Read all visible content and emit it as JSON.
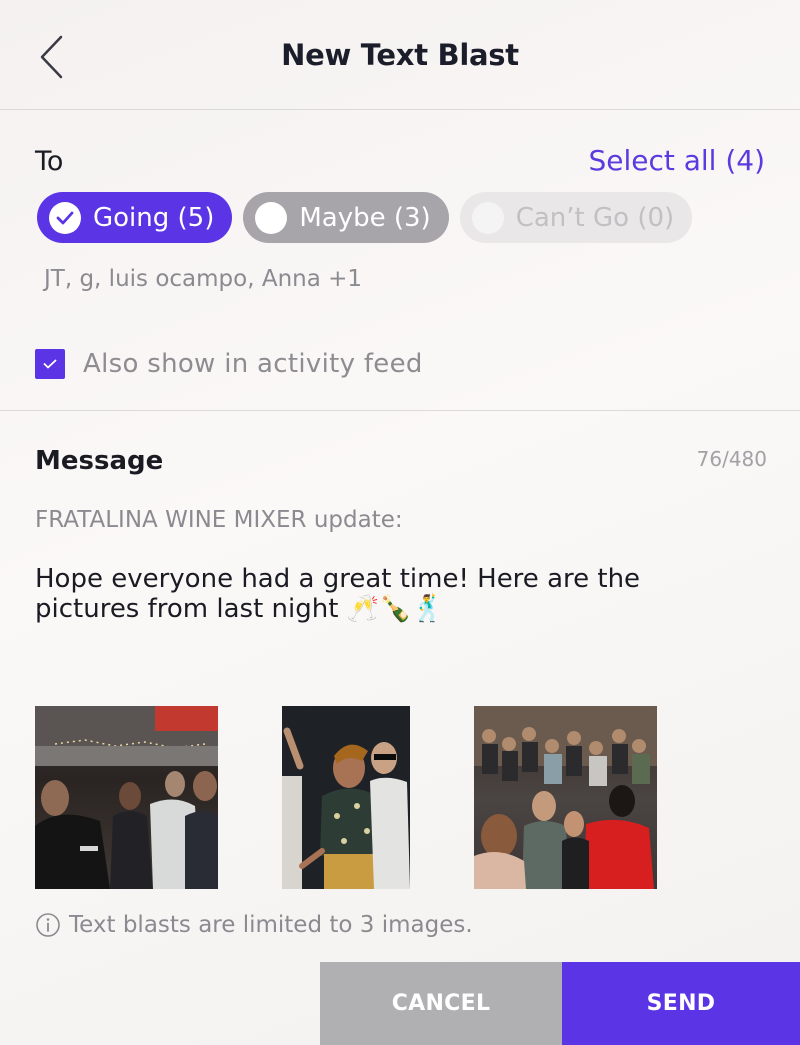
{
  "header": {
    "title": "New Text Blast",
    "back_icon": "chevron-left-icon"
  },
  "recipients": {
    "to_label": "To",
    "select_all_label": "Select all (4)",
    "chips": [
      {
        "label": "Going (5)",
        "selected": true,
        "state": "active"
      },
      {
        "label": "Maybe (3)",
        "selected": false,
        "state": "enabled"
      },
      {
        "label": "Can’t Go (0)",
        "selected": false,
        "state": "disabled"
      }
    ],
    "names": "JT, g, luis ocampo, Anna +1"
  },
  "activity_feed": {
    "label": "Also show in activity feed",
    "checked": true
  },
  "message": {
    "label": "Message",
    "counter": "76/480",
    "subject": "FRATALINA WINE MIXER update:",
    "body": "Hope everyone had a great time! Here are the pictures from last night 🥂🍾🕺"
  },
  "images": [
    {
      "name": "party-photo-1"
    },
    {
      "name": "party-photo-2"
    },
    {
      "name": "party-photo-3"
    }
  ],
  "note": {
    "icon": "info-icon",
    "text": "Text blasts are limited to 3 images."
  },
  "actions": {
    "cancel_label": "CANCEL",
    "send_label": "SEND"
  },
  "colors": {
    "accent": "#5b35e5",
    "cancel_bg": "#b0b0b3",
    "muted_text": "#8b8a90"
  }
}
